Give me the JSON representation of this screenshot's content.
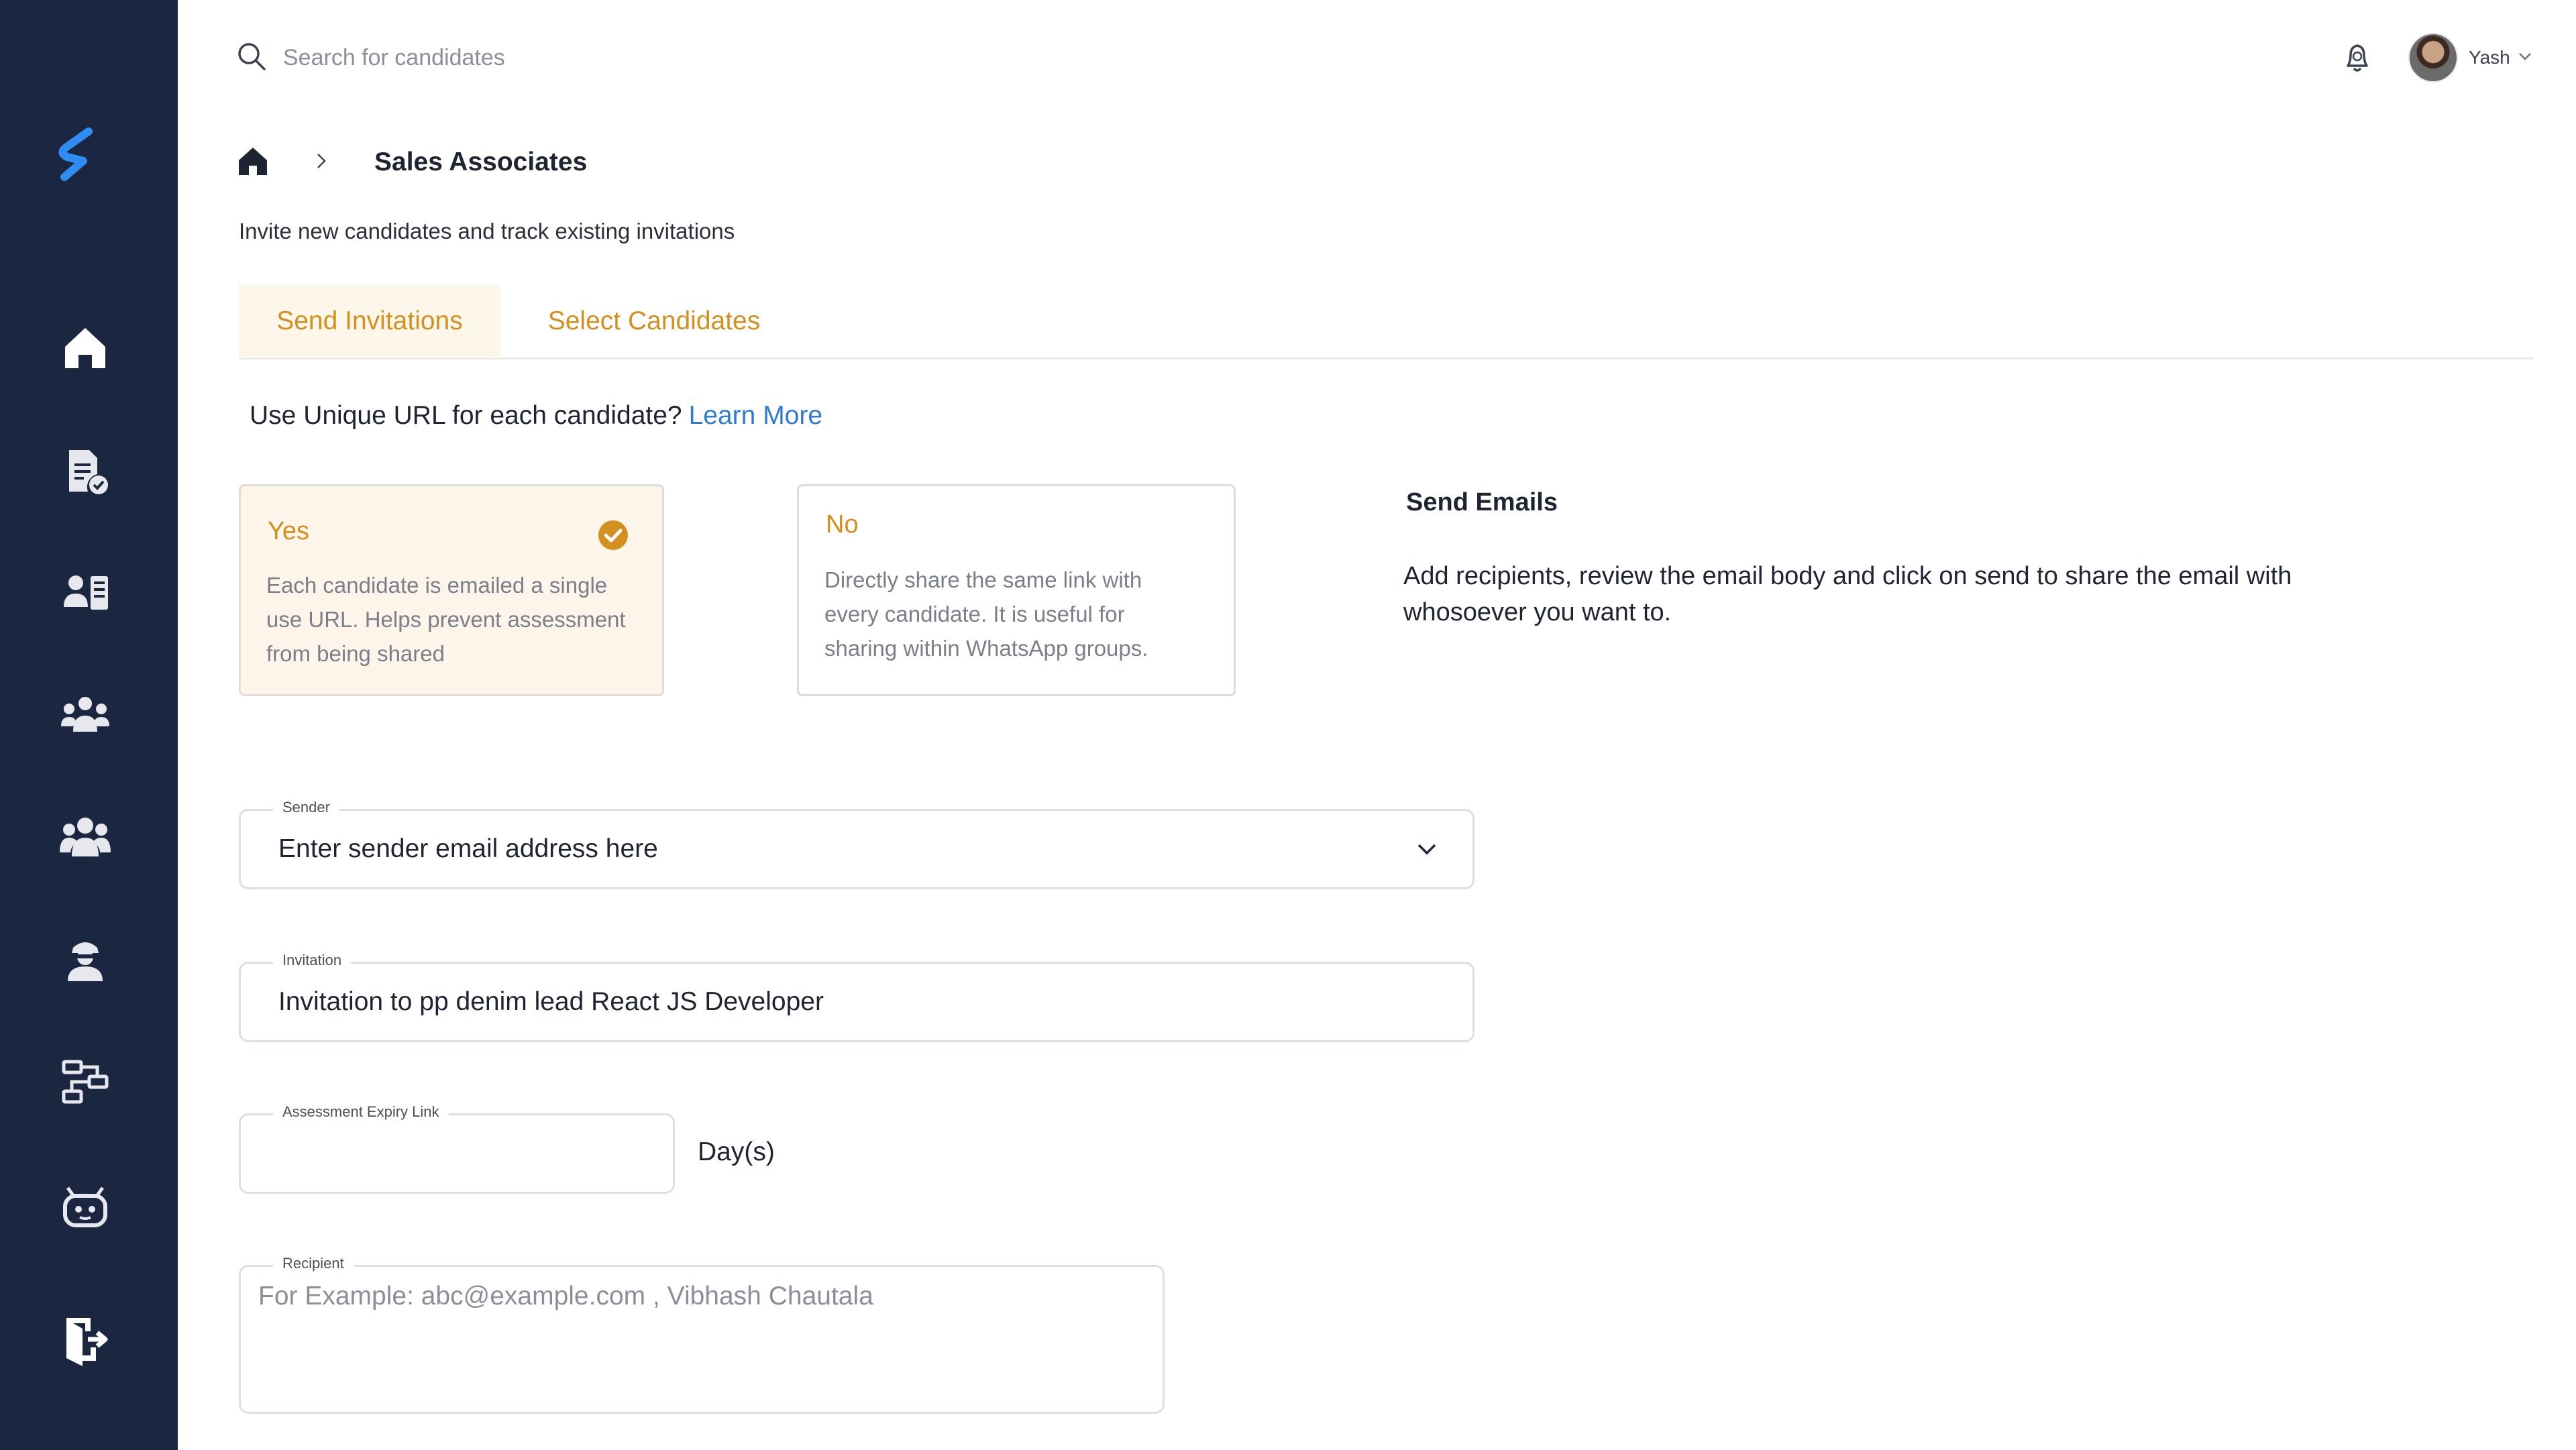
{
  "search": {
    "placeholder": "Search for candidates"
  },
  "user": {
    "name": "Yash"
  },
  "breadcrumb": {
    "current": "Sales Associates"
  },
  "page": {
    "subtitle": "Invite new candidates and track existing invitations"
  },
  "tabs": [
    {
      "label": "Send Invitations",
      "active": true
    },
    {
      "label": "Select Candidates",
      "active": false
    }
  ],
  "unique_url": {
    "question": "Use Unique URL for each candidate?",
    "link": "Learn More"
  },
  "options": {
    "yes": {
      "title": "Yes",
      "desc": "Each candidate is emailed a single use URL. Helps prevent assessment from being shared",
      "selected": true
    },
    "no": {
      "title": "No",
      "desc": "Directly share the same link with every candidate. It is useful for sharing within WhatsApp groups.",
      "selected": false
    }
  },
  "send_emails": {
    "title": "Send Emails",
    "desc": "Add recipients, review the email body and click on send to share the email with whosoever you want to."
  },
  "form": {
    "sender": {
      "label": "Sender",
      "value": "Enter sender email address here"
    },
    "invitation": {
      "label": "Invitation",
      "value": "Invitation to pp denim lead React JS Developer"
    },
    "expiry": {
      "label": "Assessment Expiry Link",
      "value": "",
      "unit": "Day(s)"
    },
    "recipient": {
      "label": "Recipient",
      "placeholder": "For Example: abc@example.com , Vibhash Chautala"
    }
  },
  "colors": {
    "sidebar": "#1b2640",
    "accent": "#d4901f",
    "link": "#2e7bd6",
    "logo": "#2f8cf0"
  }
}
